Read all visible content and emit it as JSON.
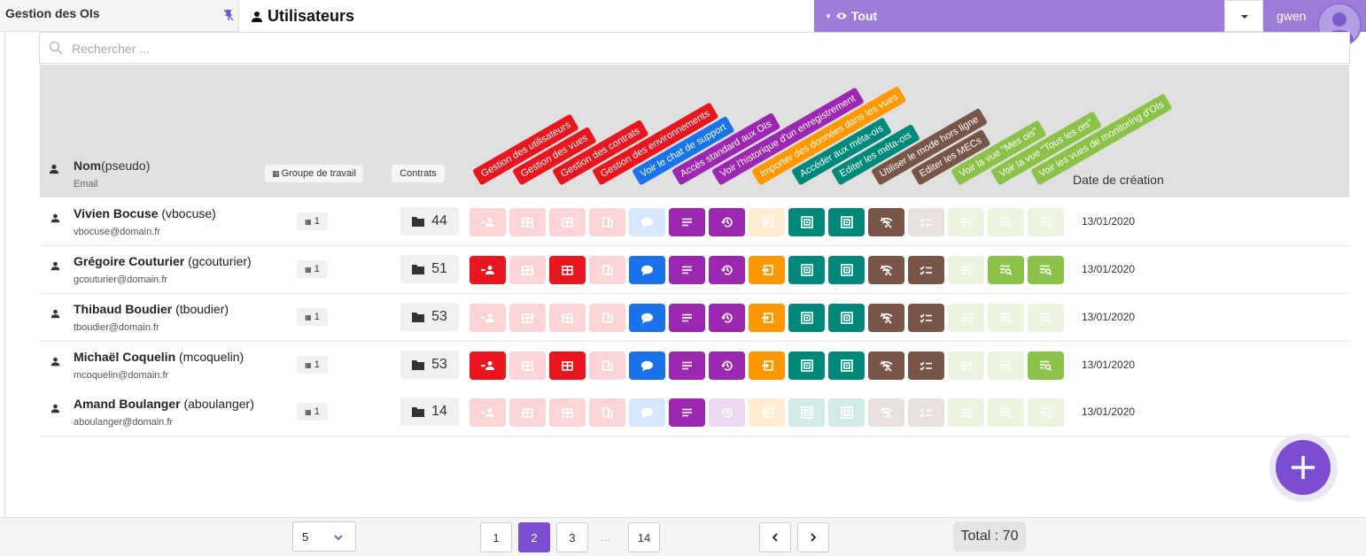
{
  "app_title": "Gestion des OIs",
  "page_title": "Utilisateurs",
  "scope": {
    "label": "Tout"
  },
  "user": {
    "name": "gwen"
  },
  "search": {
    "placeholder": "Rechercher ..."
  },
  "table": {
    "header": {
      "name_label": "Nom",
      "pseudo_label": "(pseudo)",
      "email_label": "Email",
      "group_label": "Groupe de travail",
      "contracts_label": "Contrats",
      "date_label": "Date de création"
    },
    "permissions": [
      {
        "label": "Gestion des utilisateurs",
        "color": "#e8161d",
        "icon": "user-share-icon"
      },
      {
        "label": "Gestion des vues",
        "color": "#e8161d",
        "icon": "table-icon"
      },
      {
        "label": "Gestion des contrats",
        "color": "#e8161d",
        "icon": "table-icon"
      },
      {
        "label": "Gestion des environnements",
        "color": "#e8161d",
        "icon": "building-icon"
      },
      {
        "label": "Voir le chat de support",
        "color": "#1a73e8",
        "icon": "chat-icon"
      },
      {
        "label": "Accès standard aux OIs",
        "color": "#9c27b0",
        "icon": "lines-icon"
      },
      {
        "label": "Voir l'historique d'un enregistrement",
        "color": "#9c27b0",
        "icon": "history-icon"
      },
      {
        "label": "Importer des données dans les vues",
        "color": "#ff9800",
        "icon": "import-icon"
      },
      {
        "label": "Accéder aux méta-ois",
        "color": "#00897b",
        "icon": "meta-icon"
      },
      {
        "label": "Editer les méta-ois",
        "color": "#00897b",
        "icon": "meta-icon"
      },
      {
        "label": "Utiliser le mode hors ligne",
        "color": "#795548",
        "icon": "wifi-off-icon"
      },
      {
        "label": "Editer les MECs",
        "color": "#795548",
        "icon": "checklist-icon"
      },
      {
        "label": "Voir la vue \"Mes ois\"",
        "color": "#8bc34a",
        "icon": "list-icon"
      },
      {
        "label": "Voir la vue \"Tous les ois\"",
        "color": "#8bc34a",
        "icon": "list-search-icon"
      },
      {
        "label": "Voir les vues de monitoring d'OIs",
        "color": "#8bc34a",
        "icon": "list-search-icon"
      }
    ],
    "rows": [
      {
        "name": "Vivien Bocuse",
        "pseudo": "(vbocuse)",
        "email": "vbocuse@domain.fr",
        "group": "1",
        "contracts": "44",
        "perms": [
          0,
          0,
          0,
          0,
          0,
          1,
          1,
          0,
          1,
          1,
          1,
          0,
          0,
          0,
          0
        ],
        "date": "13/01/2020"
      },
      {
        "name": "Grégoire Couturier",
        "pseudo": "(gcouturier)",
        "email": "gcouturier@domain.fr",
        "group": "1",
        "contracts": "51",
        "perms": [
          1,
          0,
          1,
          0,
          1,
          1,
          1,
          1,
          1,
          1,
          1,
          1,
          0,
          1,
          1
        ],
        "date": "13/01/2020"
      },
      {
        "name": "Thibaud Boudier",
        "pseudo": "(tboudier)",
        "email": "tboudier@domain.fr",
        "group": "1",
        "contracts": "53",
        "perms": [
          0,
          0,
          0,
          0,
          1,
          1,
          1,
          1,
          1,
          1,
          1,
          1,
          0,
          0,
          0
        ],
        "date": "13/01/2020"
      },
      {
        "name": "Michaël Coquelin",
        "pseudo": "(mcoquelin)",
        "email": "mcoquelin@domain.fr",
        "group": "1",
        "contracts": "53",
        "perms": [
          1,
          0,
          1,
          0,
          1,
          1,
          1,
          1,
          1,
          1,
          1,
          1,
          0,
          0,
          1
        ],
        "date": "13/01/2020"
      },
      {
        "name": "Amand Boulanger",
        "pseudo": "(aboulanger)",
        "email": "aboulanger@domain.fr",
        "group": "1",
        "contracts": "14",
        "perms": [
          0,
          0,
          0,
          0,
          0,
          1,
          0,
          0,
          0,
          0,
          0,
          0,
          0,
          0,
          0
        ],
        "date": "13/01/2020"
      }
    ]
  },
  "pagination": {
    "per_page": "5",
    "pages": [
      "1",
      "2",
      "3",
      "14"
    ],
    "active_page": "2",
    "ellipsis": "...",
    "total_label": "Total : 70"
  },
  "colors": {
    "accent": "#7c4dd0",
    "scope_bar": "#9c7bd9"
  }
}
